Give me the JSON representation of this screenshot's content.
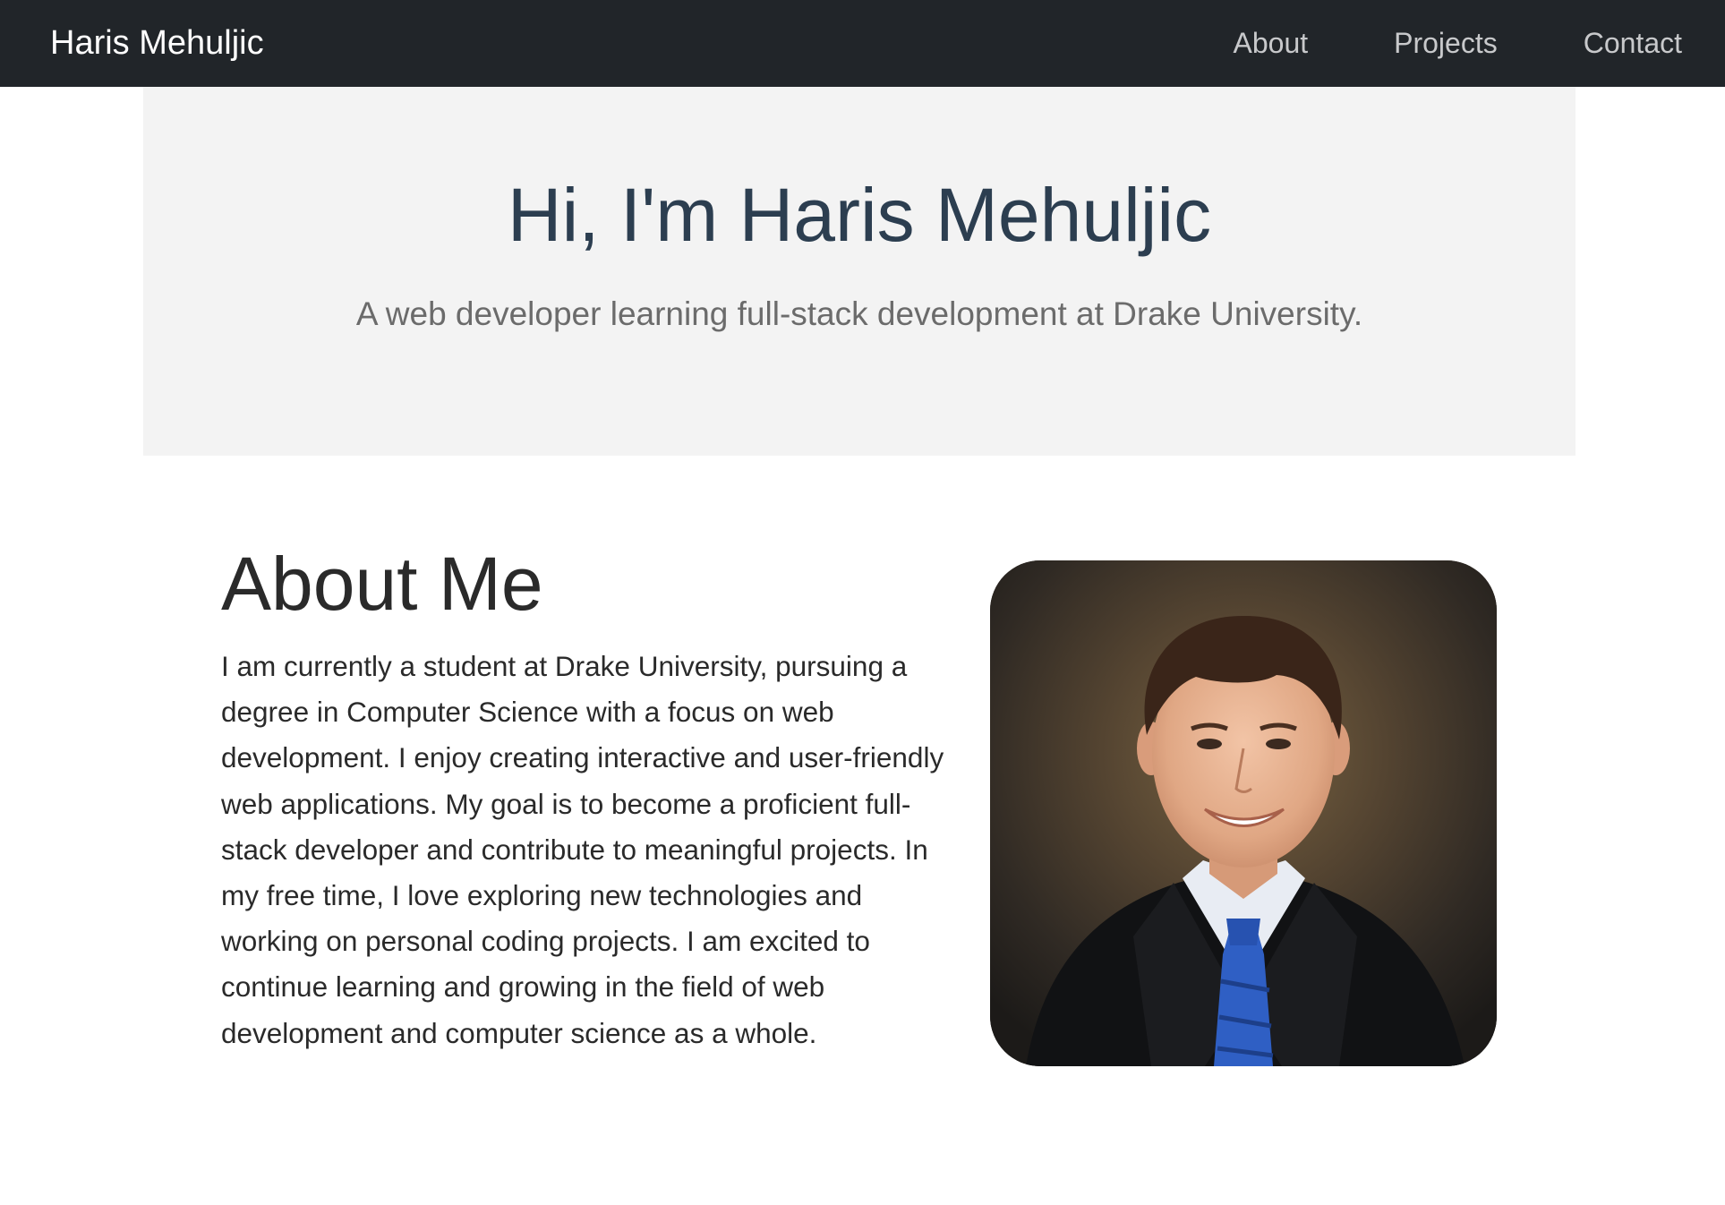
{
  "navbar": {
    "brand": "Haris Mehuljic",
    "links": [
      {
        "label": "About"
      },
      {
        "label": "Projects"
      },
      {
        "label": "Contact"
      }
    ]
  },
  "hero": {
    "title": "Hi, I'm Haris Mehuljic",
    "subtitle": "A web developer learning full-stack development at Drake University."
  },
  "about": {
    "title": "About Me",
    "text": "I am currently a student at Drake University, pursuing a degree in Computer Science with a focus on web development. I enjoy creating interactive and user-friendly web applications. My goal is to become a proficient full-stack developer and contribute to meaningful projects. In my free time, I love exploring new technologies and working on personal coding projects. I am excited to continue learning and growing in the field of web development and computer science as a whole."
  },
  "colors": {
    "navbar_bg": "#212529",
    "hero_bg": "#f3f3f3",
    "hero_title": "#2c3e50",
    "tie_blue": "#2f5fc4"
  }
}
